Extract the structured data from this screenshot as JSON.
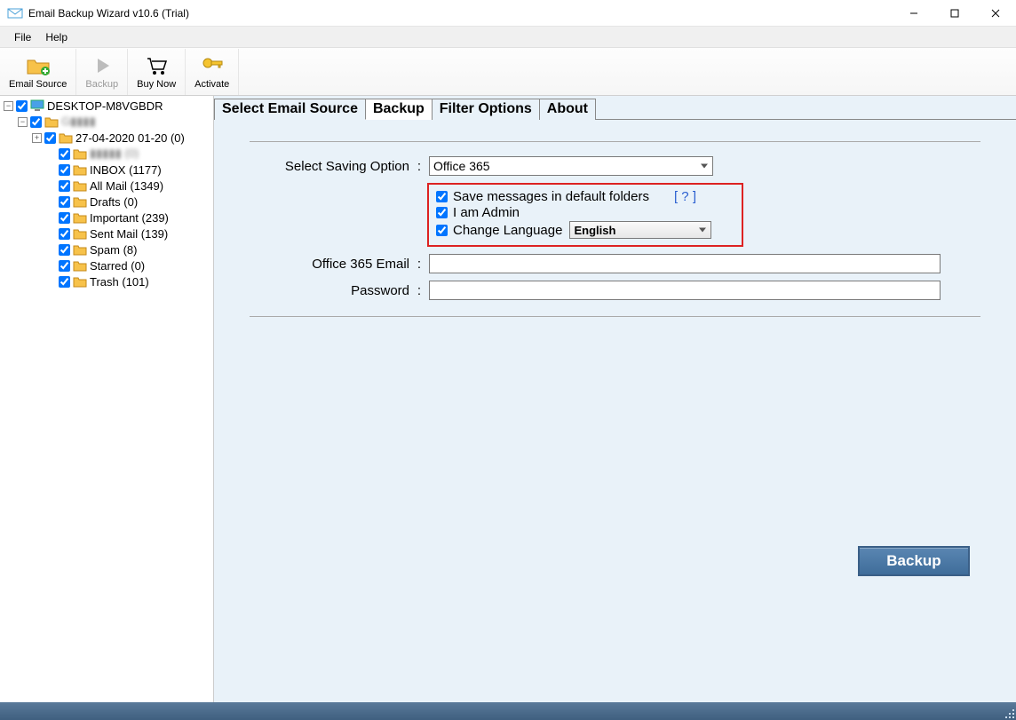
{
  "window": {
    "title": "Email Backup Wizard v10.6 (Trial)"
  },
  "menubar": {
    "file": "File",
    "help": "Help"
  },
  "toolbar": {
    "email_source": "Email Source",
    "backup": "Backup",
    "buy_now": "Buy Now",
    "activate": "Activate"
  },
  "tree": {
    "root": "DESKTOP-M8VGBDR",
    "account": "G▮▮▮▮",
    "nodes": [
      {
        "label": "27-04-2020 01-20 (0)",
        "expandable": true
      },
      {
        "label": "▮▮▮▮▮ (0)",
        "blur": true
      },
      {
        "label": "INBOX (1177)"
      },
      {
        "label": "All Mail (1349)"
      },
      {
        "label": "Drafts (0)"
      },
      {
        "label": "Important (239)"
      },
      {
        "label": "Sent Mail (139)"
      },
      {
        "label": "Spam (8)"
      },
      {
        "label": "Starred (0)"
      },
      {
        "label": "Trash (101)"
      }
    ]
  },
  "tabs": {
    "select_source": "Select Email Source",
    "backup": "Backup",
    "filter": "Filter Options",
    "about": "About",
    "active": "backup"
  },
  "form": {
    "saving_option_label": "Select Saving Option",
    "saving_option_value": "Office 365",
    "chk_default_folders": "Save messages in default folders",
    "help_link": "[ ? ]",
    "chk_admin": "I am Admin",
    "chk_change_lang": "Change Language",
    "language_value": "English",
    "email_label": "Office 365 Email",
    "email_value": "",
    "password_label": "Password",
    "password_value": "",
    "backup_button": "Backup"
  }
}
